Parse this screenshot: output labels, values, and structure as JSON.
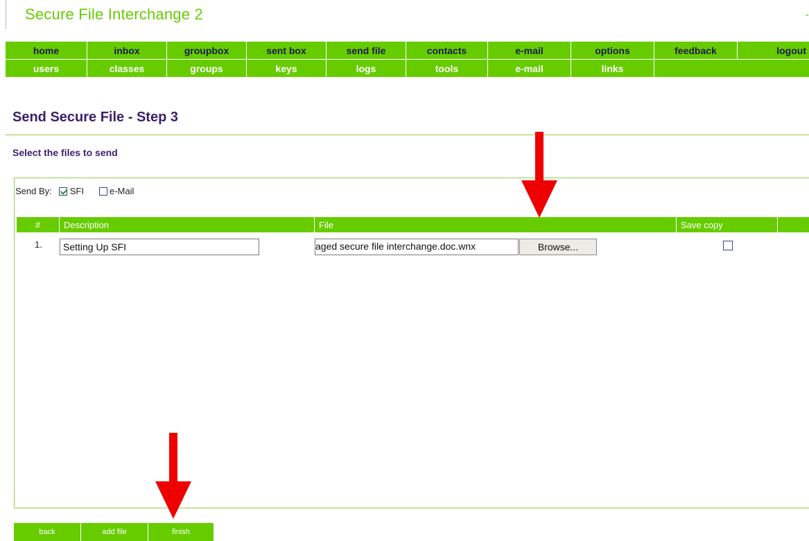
{
  "app": {
    "title": "Secure File Interchange 2",
    "title_edge": "-"
  },
  "nav_primary": [
    {
      "label": "home"
    },
    {
      "label": "inbox"
    },
    {
      "label": "groupbox"
    },
    {
      "label": "sent box"
    },
    {
      "label": "send file"
    },
    {
      "label": "contacts"
    },
    {
      "label": "e-mail"
    },
    {
      "label": "options"
    },
    {
      "label": "feedback"
    },
    {
      "label": "logout"
    }
  ],
  "nav_admin": [
    {
      "label": "users"
    },
    {
      "label": "classes"
    },
    {
      "label": "groups"
    },
    {
      "label": "keys"
    },
    {
      "label": "logs"
    },
    {
      "label": "tools"
    },
    {
      "label": "e-mail"
    },
    {
      "label": "links"
    },
    {
      "label": ""
    }
  ],
  "page": {
    "heading": "Send Secure File - Step 3",
    "subheading": "Select the files to send"
  },
  "send_by": {
    "label": "Send By:",
    "options": [
      {
        "label": "SFI",
        "checked": true
      },
      {
        "label": "e-Mail",
        "checked": false
      }
    ]
  },
  "table": {
    "headers": [
      "#",
      "Description",
      "File",
      "Save copy",
      ""
    ],
    "rows": [
      {
        "number": "1.",
        "description": "Setting Up SFI",
        "file": "aged secure file interchange.doc.wnx",
        "browse_label": "Browse...",
        "save_copy": false
      }
    ]
  },
  "buttons": {
    "back": "back",
    "add_file": "add file",
    "finish": "finish"
  },
  "colors": {
    "accent_green": "#66cc00",
    "heading_purple": "#3a1f6e",
    "annotation_red": "#ee0000"
  }
}
